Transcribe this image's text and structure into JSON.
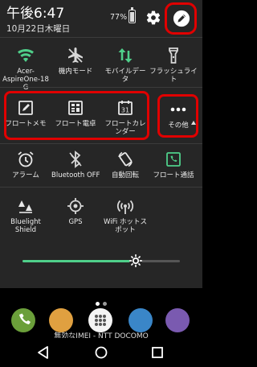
{
  "status_bar": {
    "time": "午後6:47",
    "date": "10月22日木曜日",
    "battery": "77%",
    "battery_level": 0.77
  },
  "quick_settings": {
    "row1": [
      {
        "label": "Acer-",
        "label2": "AspireOne-18",
        "label3": "G",
        "icon": "wifi-icon",
        "active": true
      },
      {
        "label": "機内モード",
        "icon": "airplane-icon",
        "active": false
      },
      {
        "label": "モバイルデー",
        "label2": "タ",
        "icon": "mobile-data-icon",
        "active": true
      },
      {
        "label": "フラッシュライ",
        "label2": "ト",
        "icon": "flashlight-icon",
        "active": false
      }
    ],
    "row2": [
      {
        "label": "フロートメモ",
        "icon": "float-memo-icon"
      },
      {
        "label": "フロート電卓",
        "icon": "float-calculator-icon"
      },
      {
        "label": "フロートカレ",
        "label2": "ンダー",
        "icon": "float-calendar-icon",
        "calendar_day": "31"
      },
      {
        "label": "その他",
        "icon": "more-icon"
      }
    ],
    "row3": [
      {
        "label": "アラーム",
        "icon": "alarm-icon"
      },
      {
        "label": "Bluetooth OFF",
        "icon": "bluetooth-off-icon"
      },
      {
        "label": "自動回転",
        "icon": "auto-rotate-icon"
      },
      {
        "label": "フロート通話",
        "icon": "float-call-icon"
      }
    ],
    "row4": [
      {
        "label": "Bluelight",
        "label2": "Shield",
        "icon": "bluelight-shield-icon"
      },
      {
        "label": "GPS",
        "icon": "gps-icon"
      },
      {
        "label": "WiFi ホットス",
        "label2": "ポット",
        "icon": "wifi-hotspot-icon"
      }
    ]
  },
  "brightness": {
    "level": 0.72
  },
  "colors": {
    "panel_bg": "#262626",
    "accent_green": "#4fcf8a",
    "highlight_red": "#e00000"
  },
  "home": {
    "page_indicator": {
      "pages": 2,
      "current": 1
    },
    "carrier_text": "無効なIMEI - NTT DOCOMO"
  }
}
